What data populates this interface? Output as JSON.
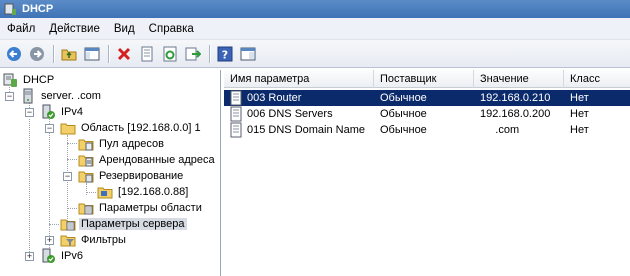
{
  "window": {
    "title": "DHCP"
  },
  "menu": [
    "Файл",
    "Действие",
    "Вид",
    "Справка"
  ],
  "toolbar": [
    "back-icon",
    "forward-icon",
    "up-folder-icon",
    "show-hide-tree-icon",
    "delete-icon",
    "properties-icon",
    "refresh-icon",
    "export-icon",
    "help-icon",
    "console-icon"
  ],
  "tree": {
    "root": "DHCP",
    "server": "server.     .com",
    "ipv4": "IPv4",
    "scope": "Область [192.168.0.0] 1",
    "pool": "Пул адресов",
    "leases": "Арендованные адреса",
    "reservations": "Резервирование",
    "reservation_item": "[192.168.0.88]",
    "scope_options": "Параметры области",
    "server_options": "Параметры сервера",
    "filters": "Фильтры",
    "ipv6": "IPv6"
  },
  "list": {
    "columns": [
      "Имя параметра",
      "Поставщик",
      "Значение",
      "Класс"
    ],
    "rows": [
      {
        "name": "003 Router",
        "vendor": "Обычное",
        "value": "192.168.0.210",
        "class": "Нет"
      },
      {
        "name": "006 DNS Servers",
        "vendor": "Обычное",
        "value": "192.168.0.200",
        "class": "Нет"
      },
      {
        "name": "015 DNS Domain Name",
        "vendor": "Обычное",
        "value": "     .com",
        "class": "Нет"
      }
    ]
  },
  "colors": {
    "selection": "#0b2a6b",
    "titlebar": "#4a7dbf"
  }
}
